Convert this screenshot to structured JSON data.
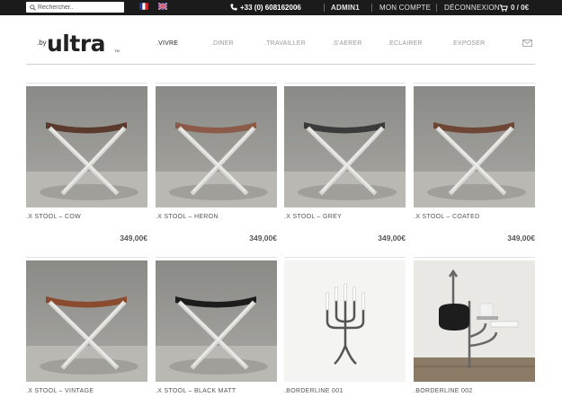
{
  "topbar": {
    "search_placeholder": "Rechercher..",
    "phone": "+33 (0) 608162006",
    "account_user": "ADMIN1",
    "account_link": "MON COMPTE",
    "logout": "DÉCONNEXION",
    "cart": "0 / 0€",
    "languages": [
      "fr",
      "en"
    ]
  },
  "brand": {
    "prefix": ".by",
    "name": "ultra",
    "tm": "TM"
  },
  "nav": [
    ".VIVRE",
    ".DINER",
    ".TRAVAILLER",
    ".S'AERER",
    ".ECLAIRER",
    ".EXPOSER"
  ],
  "nav_active": ".VIVRE",
  "colors": {
    "topbar": "#1b1b1b",
    "text": "#555555",
    "accent": "#222222"
  },
  "products": [
    {
      "name": ".X STOOL – COW",
      "price": "349,00€",
      "seat": "#5a3a2c"
    },
    {
      "name": ".X STOOL – HERON",
      "price": "349,00€",
      "seat": "#8b5a48"
    },
    {
      "name": ".X STOOL – GREY",
      "price": "349,00€",
      "seat": "#3b3b3b"
    },
    {
      "name": ".X STOOL – COATED",
      "price": "349,00€",
      "seat": "#6e4636"
    },
    {
      "name": ".X STOOL – VINTAGE",
      "price": "",
      "seat": "#8a4b2e"
    },
    {
      "name": ".X STOOL – BLACK MATT",
      "price": "",
      "seat": "#1c1c1c"
    },
    {
      "name": ".BORDERLINE 001",
      "price": ""
    },
    {
      "name": ".BORDERLINE 002",
      "price": ""
    }
  ]
}
